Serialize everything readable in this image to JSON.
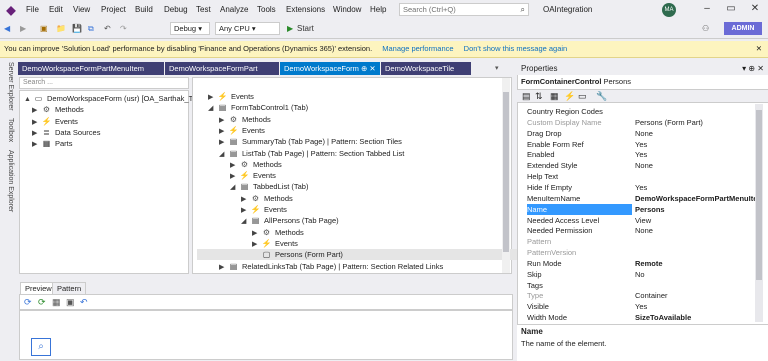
{
  "menu": [
    "File",
    "Edit",
    "View",
    "Project",
    "Build",
    "Debug",
    "Test",
    "Analyze",
    "Tools",
    "Extensions",
    "Window",
    "Help"
  ],
  "search": {
    "placeholder": "Search (Ctrl+Q)"
  },
  "solution_name": "OAIntegration",
  "user_initials": "MA",
  "admin_label": "ADMIN",
  "toolbar": {
    "config": "Debug",
    "platform": "Any CPU",
    "start": "Start"
  },
  "infobar": {
    "message": "You can improve 'Solution Load' performance by disabling 'Finance and Operations (Dynamics 365)' extension.",
    "manage": "Manage performance",
    "dismiss": "Don't show this message again"
  },
  "side_tabs": [
    "Server Explorer",
    "Toolbox",
    "Application Explorer"
  ],
  "doc_tabs": [
    "DemoWorkspaceFormPartMenuItem",
    "DemoWorkspaceFormPart",
    "DemoWorkspaceForm",
    "DemoWorkspaceTile"
  ],
  "left_search_placeholder": "Search ...",
  "left_tree": [
    {
      "label": "DemoWorkspaceForm (usr) [OA_Sarthak_Trainir",
      "icon": "form-icon",
      "arrow": "▲"
    },
    {
      "label": "Methods",
      "icon": "methods-icon",
      "arrow": "▶"
    },
    {
      "label": "Events",
      "icon": "events-icon",
      "arrow": "▶"
    },
    {
      "label": "Data Sources",
      "icon": "datasources-icon",
      "arrow": "▶"
    },
    {
      "label": "Parts",
      "icon": "parts-icon",
      "arrow": "▶"
    }
  ],
  "right_tree": [
    {
      "label": "Events",
      "icon": "events-icon",
      "arrow": "▶",
      "indent": 1
    },
    {
      "label": "FormTabControl1 (Tab)",
      "icon": "tab-icon",
      "arrow": "◢",
      "indent": 1
    },
    {
      "label": "Methods",
      "icon": "methods-icon",
      "arrow": "▶",
      "indent": 2
    },
    {
      "label": "Events",
      "icon": "events-icon",
      "arrow": "▶",
      "indent": 2
    },
    {
      "label": "SummaryTab (Tab Page) | Pattern: Section Tiles",
      "icon": "tabpage-icon",
      "arrow": "▶",
      "indent": 2
    },
    {
      "label": "ListTab (Tab Page) | Pattern: Section Tabbed List",
      "icon": "tabpage-icon",
      "arrow": "◢",
      "indent": 2
    },
    {
      "label": "Methods",
      "icon": "methods-icon",
      "arrow": "▶",
      "indent": 3
    },
    {
      "label": "Events",
      "icon": "events-icon",
      "arrow": "▶",
      "indent": 3
    },
    {
      "label": "TabbedList (Tab)",
      "icon": "tab-icon",
      "arrow": "◢",
      "indent": 3
    },
    {
      "label": "Methods",
      "icon": "methods-icon",
      "arrow": "▶",
      "indent": 4
    },
    {
      "label": "Events",
      "icon": "events-icon",
      "arrow": "▶",
      "indent": 4
    },
    {
      "label": "AllPersons (Tab Page)",
      "icon": "tabpage-icon",
      "arrow": "◢",
      "indent": 4
    },
    {
      "label": "Methods",
      "icon": "methods-icon",
      "arrow": "▶",
      "indent": 5
    },
    {
      "label": "Events",
      "icon": "events-icon",
      "arrow": "▶",
      "indent": 5
    },
    {
      "label": "Persons (Form Part)",
      "icon": "part-icon",
      "arrow": "",
      "indent": 5,
      "selected": true
    },
    {
      "label": "RelatedLinksTab (Tab Page) | Pattern: Section Related Links",
      "icon": "tabpage-icon",
      "arrow": "▶",
      "indent": 2
    }
  ],
  "preview_tabs": [
    "Preview",
    "Pattern"
  ],
  "properties": {
    "title": "Properties",
    "object_type": "FormContainerControl",
    "object_name": "Persons",
    "rows": [
      {
        "name": "Country Region Codes",
        "value": ""
      },
      {
        "name": "Custom Display Name",
        "value": "Persons (Form Part)",
        "dim": true
      },
      {
        "name": "Drag Drop",
        "value": "None"
      },
      {
        "name": "Enable Form Ref",
        "value": "Yes"
      },
      {
        "name": "Enabled",
        "value": "Yes"
      },
      {
        "name": "Extended Style",
        "value": "None"
      },
      {
        "name": "Help Text",
        "value": ""
      },
      {
        "name": "Hide If Empty",
        "value": "Yes"
      },
      {
        "name": "MenuItemName",
        "value": "DemoWorkspaceFormPartMenuIte",
        "bold": true
      },
      {
        "name": "Name",
        "value": "Persons",
        "bold": true,
        "selected": true
      },
      {
        "name": "Needed Access Level",
        "value": "View"
      },
      {
        "name": "Needed Permission",
        "value": "None"
      },
      {
        "name": "Pattern",
        "value": "",
        "dim": true
      },
      {
        "name": "PatternVersion",
        "value": "",
        "dim": true
      },
      {
        "name": "Run Mode",
        "value": "Remote",
        "bold": true
      },
      {
        "name": "Skip",
        "value": "No"
      },
      {
        "name": "Tags",
        "value": ""
      },
      {
        "name": "Type",
        "value": "Container",
        "dim": true
      },
      {
        "name": "Visible",
        "value": "Yes"
      },
      {
        "name": "Width Mode",
        "value": "SizeToAvailable",
        "bold": true
      }
    ],
    "desc_title": "Name",
    "desc_text": "The name of the element."
  },
  "colors": {
    "accent": "#3f3f74",
    "active_tab": "#007acc",
    "selection": "#3399ff",
    "infobar": "#fdf4bf",
    "admin": "#6b6bd6"
  }
}
